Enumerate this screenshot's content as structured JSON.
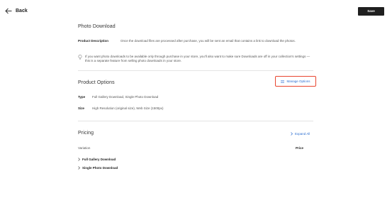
{
  "header": {
    "back_label": "Back",
    "save_label": "Save"
  },
  "photo_download": {
    "title": "Photo Download",
    "description_label": "Product Description",
    "description_value": "Once the download files are processed after purchase, you will be sent an email that contains a link to download the photos.",
    "info_text": "If you want photo downloads to be available only through purchase in your store, you'll also want to make sure Downloads are off in your collection's settings — this is a separate feature from selling photo downloads in your store."
  },
  "product_options": {
    "title": "Product Options",
    "manage_label": "Manage Options",
    "type_label": "Type",
    "type_value": "Full Gallery Download, Single Photo Download",
    "size_label": "Size",
    "size_value": "High Resolution (original size), Web Size (1500px)"
  },
  "pricing": {
    "title": "Pricing",
    "expand_label": "Expand All",
    "col_variation": "Variation",
    "col_price": "Price",
    "variations": [
      {
        "label": "Full Gallery Download"
      },
      {
        "label": "Single Photo Download"
      }
    ]
  },
  "colors": {
    "accent": "#2d6fd1",
    "highlight_border": "#e8452f",
    "save_bg": "#1f1f1f"
  }
}
